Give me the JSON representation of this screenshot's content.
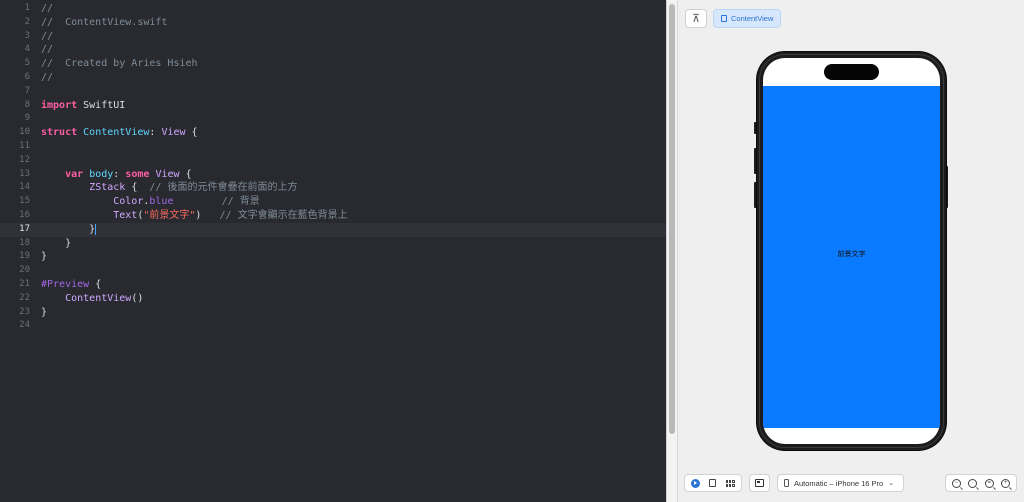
{
  "editor": {
    "current_line": 17,
    "lines": [
      {
        "n": "1",
        "tokens": [
          {
            "t": "//",
            "c": "comment"
          }
        ]
      },
      {
        "n": "2",
        "tokens": [
          {
            "t": "//  ContentView.swift",
            "c": "comment"
          }
        ]
      },
      {
        "n": "3",
        "tokens": [
          {
            "t": "//",
            "c": "comment"
          }
        ]
      },
      {
        "n": "4",
        "tokens": [
          {
            "t": "//",
            "c": "comment"
          }
        ]
      },
      {
        "n": "5",
        "tokens": [
          {
            "t": "//  Created by Aries Hsieh",
            "c": "comment"
          }
        ]
      },
      {
        "n": "6",
        "tokens": [
          {
            "t": "//",
            "c": "comment"
          }
        ]
      },
      {
        "n": "7",
        "tokens": []
      },
      {
        "n": "8",
        "tokens": [
          {
            "t": "import",
            "c": "keyword"
          },
          {
            "t": " SwiftUI",
            "c": "plain"
          }
        ]
      },
      {
        "n": "9",
        "tokens": []
      },
      {
        "n": "10",
        "tokens": [
          {
            "t": "struct",
            "c": "keyword"
          },
          {
            "t": " ",
            "c": "plain"
          },
          {
            "t": "ContentView",
            "c": "decl"
          },
          {
            "t": ": ",
            "c": "plain"
          },
          {
            "t": "View",
            "c": "type"
          },
          {
            "t": " {",
            "c": "plain"
          }
        ]
      },
      {
        "n": "11",
        "tokens": []
      },
      {
        "n": "12",
        "tokens": []
      },
      {
        "n": "13",
        "tokens": [
          {
            "t": "    ",
            "c": "plain"
          },
          {
            "t": "var",
            "c": "keyword"
          },
          {
            "t": " ",
            "c": "plain"
          },
          {
            "t": "body",
            "c": "decl"
          },
          {
            "t": ": ",
            "c": "plain"
          },
          {
            "t": "some",
            "c": "keyword"
          },
          {
            "t": " ",
            "c": "plain"
          },
          {
            "t": "View",
            "c": "type"
          },
          {
            "t": " {",
            "c": "plain"
          }
        ]
      },
      {
        "n": "14",
        "tokens": [
          {
            "t": "        ",
            "c": "plain"
          },
          {
            "t": "ZStack",
            "c": "type"
          },
          {
            "t": " {  ",
            "c": "plain"
          },
          {
            "t": "// 後面的元件會疊在前面的上方",
            "c": "comment"
          }
        ]
      },
      {
        "n": "15",
        "tokens": [
          {
            "t": "            ",
            "c": "plain"
          },
          {
            "t": "Color",
            "c": "type"
          },
          {
            "t": ".",
            "c": "plain"
          },
          {
            "t": "blue",
            "c": "member"
          },
          {
            "t": "        ",
            "c": "plain"
          },
          {
            "t": "// 背景",
            "c": "comment"
          }
        ]
      },
      {
        "n": "16",
        "tokens": [
          {
            "t": "            ",
            "c": "plain"
          },
          {
            "t": "Text",
            "c": "type"
          },
          {
            "t": "(",
            "c": "plain"
          },
          {
            "t": "\"前景文字\"",
            "c": "string"
          },
          {
            "t": ")   ",
            "c": "plain"
          },
          {
            "t": "// 文字會顯示在藍色背景上",
            "c": "comment"
          }
        ]
      },
      {
        "n": "17",
        "tokens": [
          {
            "t": "        ",
            "c": "plain"
          },
          {
            "t": "}",
            "c": "cursor"
          }
        ]
      },
      {
        "n": "18",
        "tokens": [
          {
            "t": "    }",
            "c": "plain"
          }
        ]
      },
      {
        "n": "19",
        "tokens": [
          {
            "t": "}",
            "c": "plain"
          }
        ]
      },
      {
        "n": "20",
        "tokens": []
      },
      {
        "n": "21",
        "tokens": [
          {
            "t": "#Preview",
            "c": "member"
          },
          {
            "t": " {",
            "c": "plain"
          }
        ]
      },
      {
        "n": "22",
        "tokens": [
          {
            "t": "    ",
            "c": "plain"
          },
          {
            "t": "ContentView",
            "c": "type"
          },
          {
            "t": "()",
            "c": "plain"
          }
        ]
      },
      {
        "n": "23",
        "tokens": [
          {
            "t": "}",
            "c": "plain"
          }
        ]
      },
      {
        "n": "24",
        "tokens": []
      }
    ]
  },
  "preview": {
    "pin_icon": "pin-icon",
    "tab_label": "ContentView",
    "screen_text": "前景文字",
    "screen_color": "#0a7aff"
  },
  "bottom_bar": {
    "device_label": "Automatic – iPhone 16 Pro"
  }
}
